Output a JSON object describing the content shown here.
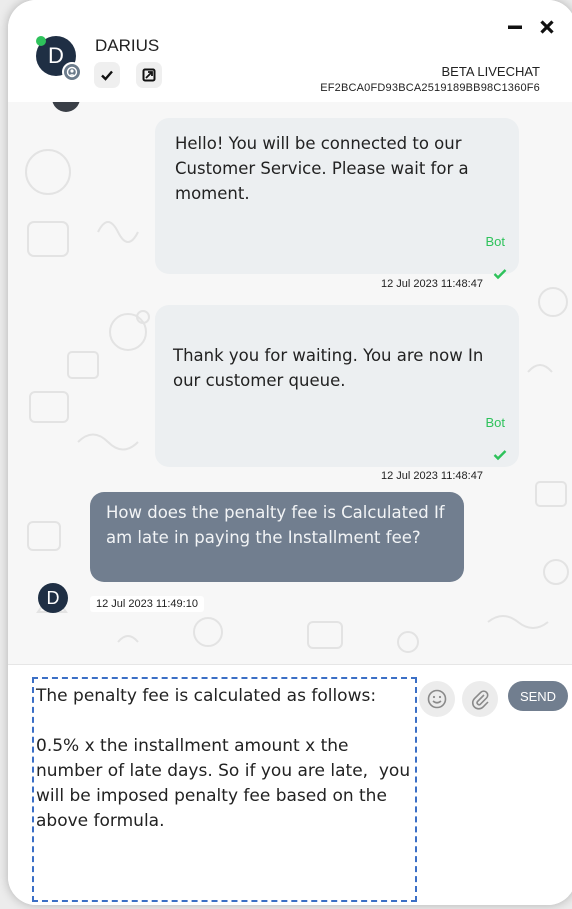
{
  "header": {
    "agent_name": "DARIUS",
    "avatar_initial": "D",
    "chat_title": "BETA LIVECHAT",
    "session_id": "EF2BCA0FD93BCA2519189BB98C1360F6"
  },
  "icons": {
    "minimize": "minimize-icon",
    "close": "close-icon",
    "resolve": "check-icon",
    "transfer": "transfer-icon",
    "emoji": "emoji-icon",
    "attach": "paperclip-icon",
    "read_receipt": "check-icon"
  },
  "messages": [
    {
      "sender": "bot",
      "text": "Hello! You will be connected to our Customer Service. Please wait for a moment.",
      "tag": "Bot",
      "timestamp": "12 Jul 2023 11:48:47"
    },
    {
      "sender": "bot",
      "text": "Thank you for waiting. You are now In our customer queue.",
      "tag": "Bot",
      "timestamp": "12 Jul 2023 11:48:47"
    },
    {
      "sender": "user",
      "text": "How does the penalty fee is Calculated If am late in paying the Installment fee?",
      "avatar_initial": "D",
      "timestamp": "12 Jul 2023 11:49:10"
    }
  ],
  "composer": {
    "draft": "The penalty fee is calculated as follows:\n\n0.5% x the installment amount x the number of late days. So if you are late,  you will be imposed penalty fee based on the above formula.",
    "send_label": "SEND"
  },
  "colors": {
    "accent": "#717e8f",
    "online": "#2ec25b",
    "bot_tag": "#2ec25b",
    "avatar": "#1f2f44",
    "bot_bubble": "#eceff1",
    "draft_border": "#3b6fc6"
  }
}
